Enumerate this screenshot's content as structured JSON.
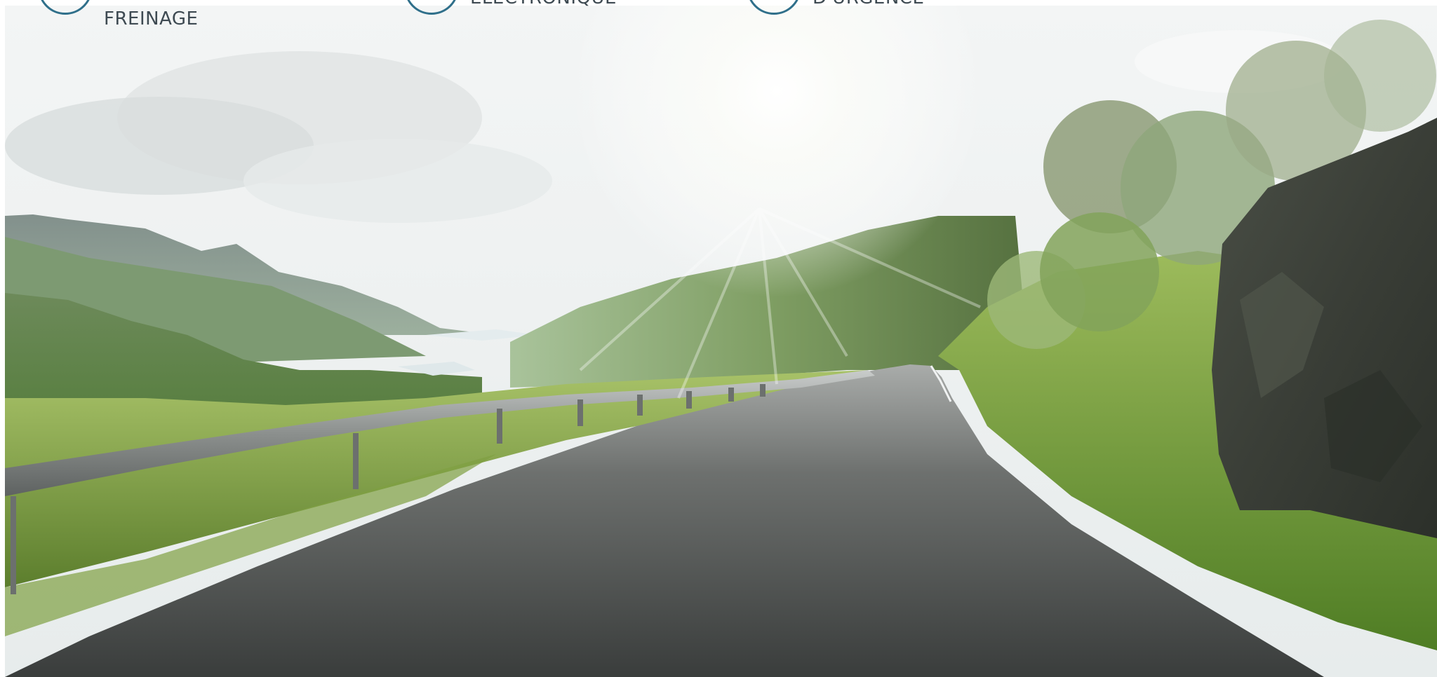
{
  "features": [
    {
      "id": "braking",
      "line1": "",
      "line2": "FREINAGE",
      "icon": "brake-icon"
    },
    {
      "id": "electronic",
      "line1": "ÉLECTRONIQUE",
      "line2": "",
      "icon": "electronic-stability-icon"
    },
    {
      "id": "emergency",
      "line1": "D'URGENCE",
      "line2": "",
      "icon": "emergency-icon"
    }
  ],
  "colors": {
    "icon_ring": "#2f6f8a",
    "label_text": "#3e4a52"
  }
}
